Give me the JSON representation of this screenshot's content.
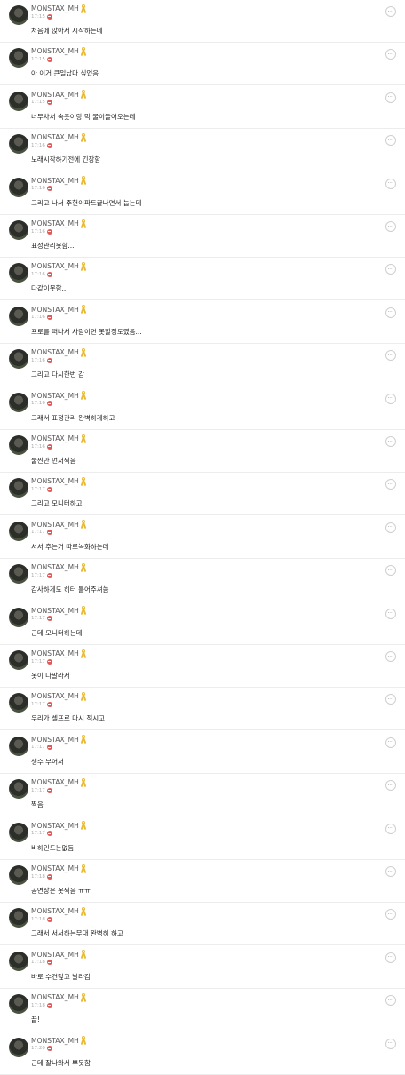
{
  "colors": {
    "ribbon": "#e8b930",
    "badge": "#e05a5a",
    "divider": "#ececec"
  },
  "icons": {
    "ribbon": "yellow-ribbon-icon",
    "badge": "red-badge-icon",
    "more": "more-options-icon"
  },
  "messages": [
    {
      "user": "MONSTAX_MH",
      "time": "17:15",
      "text": "처음에 앉아서 시작하는데"
    },
    {
      "user": "MONSTAX_MH",
      "time": "17:15",
      "text": "아 이거 큰일났다 싶었음"
    },
    {
      "user": "MONSTAX_MH",
      "time": "17:15",
      "text": "너무차서 속옷이랑 막 물이들어오는데"
    },
    {
      "user": "MONSTAX_MH",
      "time": "17:16",
      "text": "노래시작하기전에 긴장함"
    },
    {
      "user": "MONSTAX_MH",
      "time": "17:16",
      "text": "그리고 나서 주헌이파트끝나면서 눕는데"
    },
    {
      "user": "MONSTAX_MH",
      "time": "17:16",
      "text": "표정관리못함..."
    },
    {
      "user": "MONSTAX_MH",
      "time": "17:16",
      "text": "다같이못함..."
    },
    {
      "user": "MONSTAX_MH",
      "time": "17:16",
      "text": "프로를 떠나서 사람이면 못할정도였음..."
    },
    {
      "user": "MONSTAX_MH",
      "time": "17:16",
      "text": "그리고 다시한번 감"
    },
    {
      "user": "MONSTAX_MH",
      "time": "17:16",
      "text": "그래서 표정관리 완벽하게하고"
    },
    {
      "user": "MONSTAX_MH",
      "time": "17:16",
      "text": "물씬만 먼저찍음"
    },
    {
      "user": "MONSTAX_MH",
      "time": "17:17",
      "text": "그리고 모니터하고"
    },
    {
      "user": "MONSTAX_MH",
      "time": "17:17",
      "text": "서서 추는거 따로녹화하는데"
    },
    {
      "user": "MONSTAX_MH",
      "time": "17:17",
      "text": "감사하게도 히터 틀어주셔씀"
    },
    {
      "user": "MONSTAX_MH",
      "time": "17:17",
      "text": "근데 모니터하는데"
    },
    {
      "user": "MONSTAX_MH",
      "time": "17:17",
      "text": "옷이 다말라서"
    },
    {
      "user": "MONSTAX_MH",
      "time": "17:17",
      "text": "우리가 셀프로 다시 적시고"
    },
    {
      "user": "MONSTAX_MH",
      "time": "17:17",
      "text": "생수 부어서"
    },
    {
      "user": "MONSTAX_MH",
      "time": "17:17",
      "text": "찍음"
    },
    {
      "user": "MONSTAX_MH",
      "time": "17:17",
      "text": "비하인드는없듬"
    },
    {
      "user": "MONSTAX_MH",
      "time": "17:18",
      "text": "공연장은 못찍음 ㅠㅠ"
    },
    {
      "user": "MONSTAX_MH",
      "time": "17:18",
      "text": "그래서 서서하는무대 완벽히 하고"
    },
    {
      "user": "MONSTAX_MH",
      "time": "17:18",
      "text": "바로 수건덮고 날라감"
    },
    {
      "user": "MONSTAX_MH",
      "time": "17:18",
      "text": "끝!"
    },
    {
      "user": "MONSTAX_MH",
      "time": "17:20",
      "text": "근데 잘나와서 뿌듯함"
    }
  ]
}
